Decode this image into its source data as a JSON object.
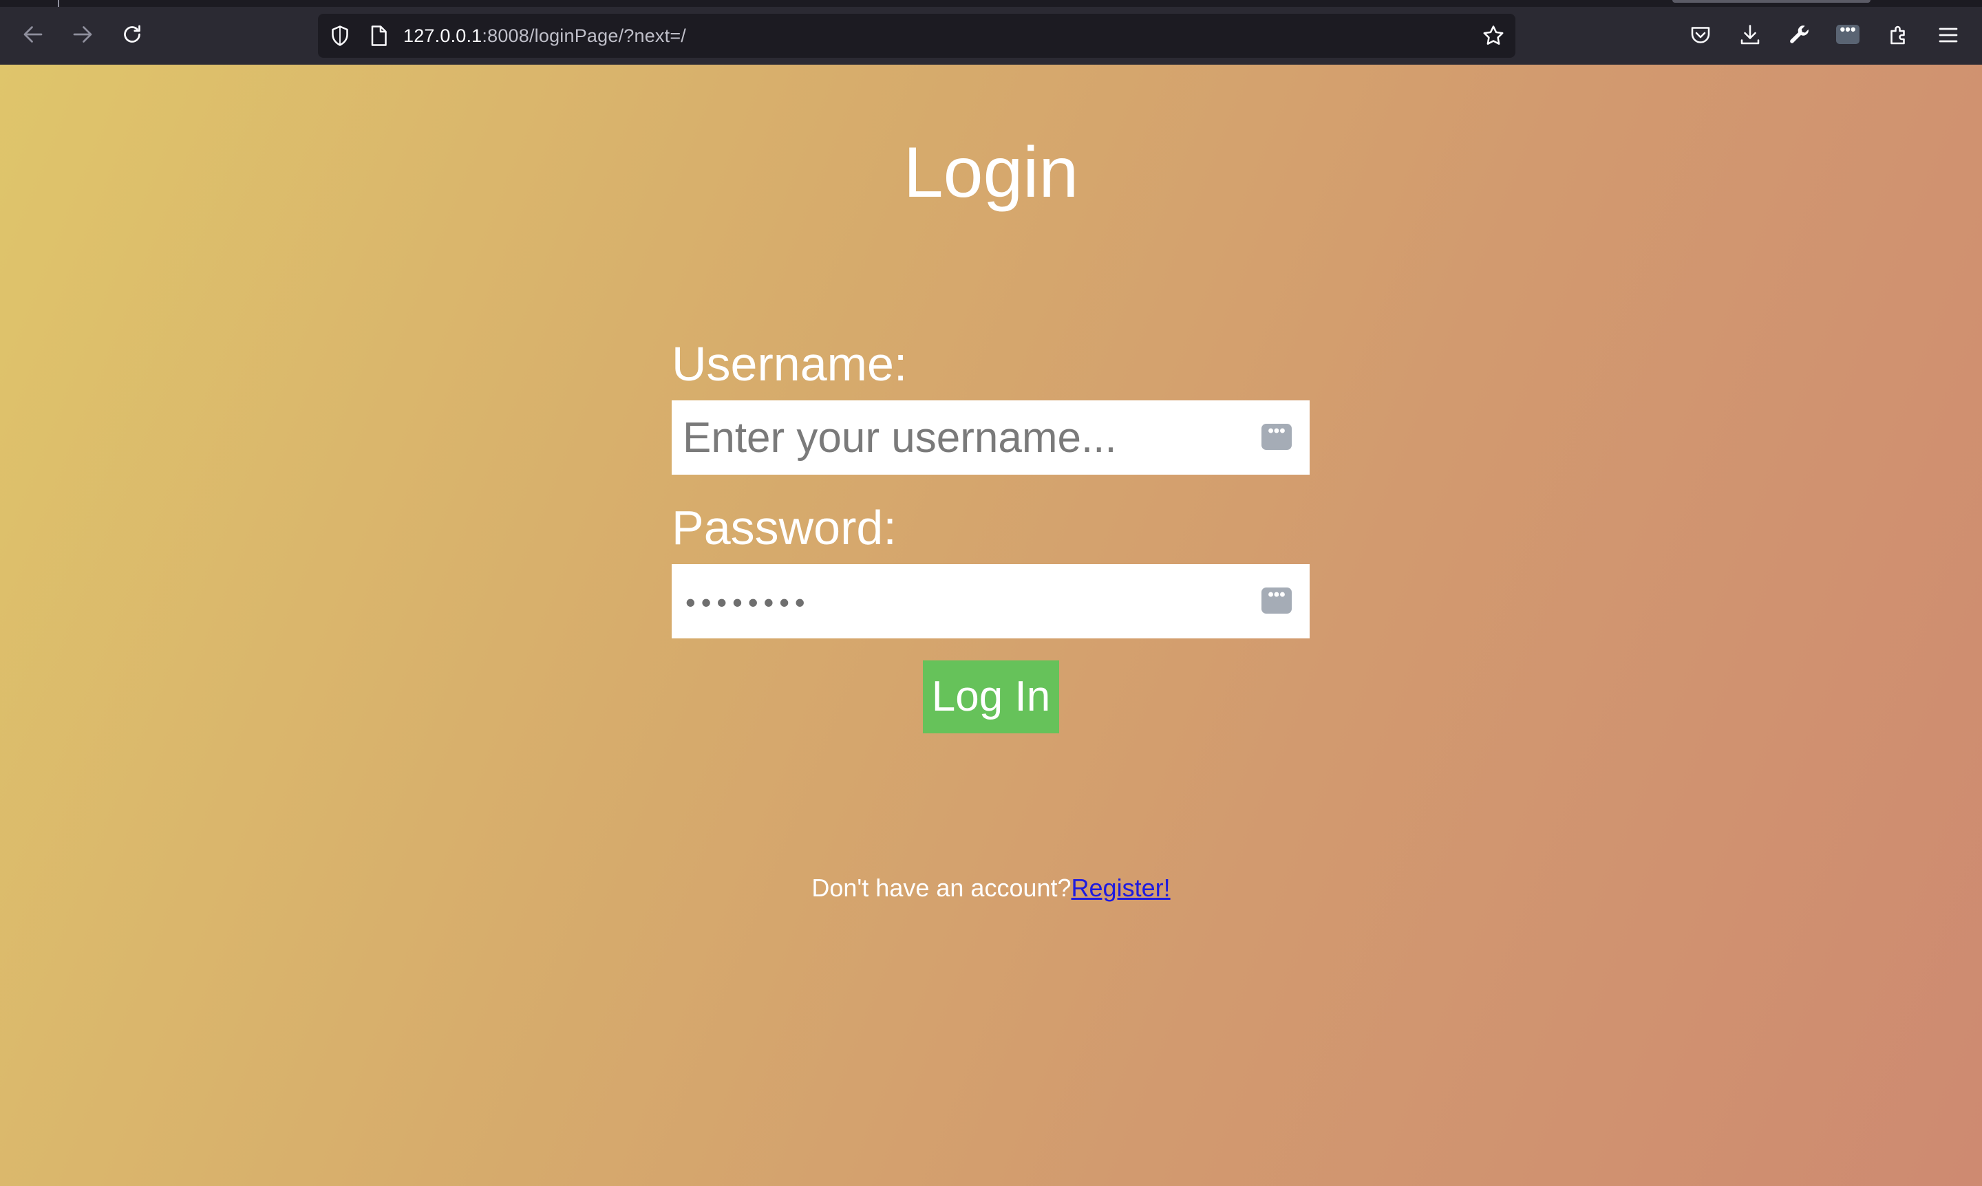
{
  "browser": {
    "url_host": "127.0.0.1",
    "url_rest": ":8008/loginPage/?next=/",
    "icons": {
      "back": "arrow-left-icon",
      "forward": "arrow-right-icon",
      "reload": "reload-icon",
      "tracking": "shield-icon",
      "page": "page-icon",
      "bookmark": "star-icon",
      "pocket": "pocket-icon",
      "downloads": "download-icon",
      "devtools": "wrench-icon",
      "extension": "password-manager-icon",
      "extensions": "puzzle-icon",
      "menu": "hamburger-menu-icon"
    },
    "extension_badge": "•••"
  },
  "login": {
    "title": "Login",
    "username_label": "Username:",
    "username_placeholder": "Enter your username...",
    "password_label": "Password:",
    "password_mask": "••••••••",
    "password_manager_glyph": "•••",
    "submit_label": "Log In",
    "register_prompt": "Don't have an account?",
    "register_link": "Register!"
  },
  "colors": {
    "gradient_start": "#dfc56b",
    "gradient_end": "#ce8a71",
    "button_green": "#66c25a",
    "link_blue": "#1d1ae0"
  }
}
